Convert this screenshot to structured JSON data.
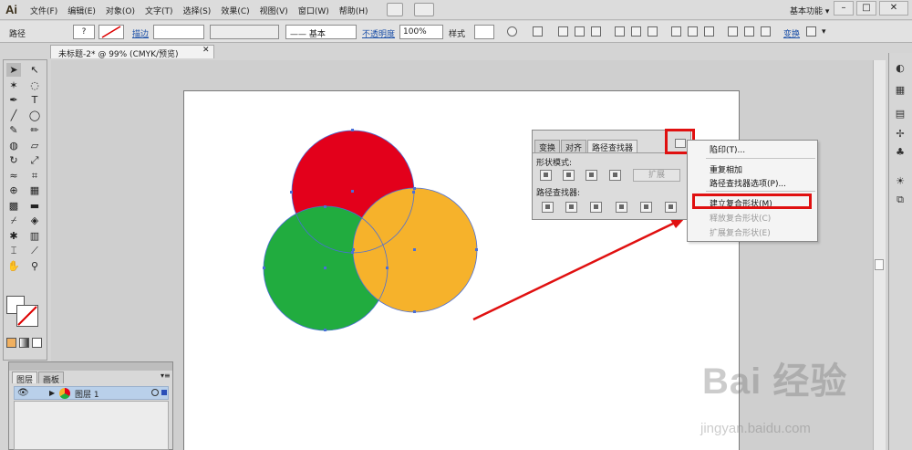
{
  "app": {
    "logo": "Ai"
  },
  "menu": [
    "文件(F)",
    "编辑(E)",
    "对象(O)",
    "文字(T)",
    "选择(S)",
    "效果(C)",
    "视图(V)",
    "窗口(W)",
    "帮助(H)"
  ],
  "workspace": {
    "label": "基本功能 ▾"
  },
  "window_controls": {
    "minimize": "–",
    "maximize": "□",
    "close": "✕"
  },
  "controlbar": {
    "selection_label": "路径",
    "fill_value": "?",
    "stroke_label": "描边",
    "brush_label": "—— 基本",
    "opacity_label": "不透明度",
    "opacity_value": "100%",
    "style_label": "样式",
    "transform_label": "变换"
  },
  "document": {
    "tab_title": "未标题-2* @ 99% (CMYK/预览)",
    "close": "✕"
  },
  "pathfinder": {
    "tabs": [
      "变换",
      "对齐",
      "路径查找器"
    ],
    "shape_modes_label": "形状模式:",
    "expand_label": "扩展",
    "pathfinders_label": "路径查找器:"
  },
  "flyout": {
    "items": [
      "陷印(T)...",
      "重复相加",
      "路径查找器选项(P)...",
      "建立复合形状(M)",
      "释放复合形状(C)",
      "扩展复合形状(E)"
    ],
    "highlighted": "建立复合形状(M)"
  },
  "layers": {
    "tabs": [
      "图层",
      "画板"
    ],
    "layer_name": "图层 1"
  },
  "artwork": {
    "circles": [
      {
        "name": "red-circle",
        "color": "#e3001b"
      },
      {
        "name": "green-circle",
        "color": "#21ac3f"
      },
      {
        "name": "orange-circle",
        "color": "#f6b22b"
      }
    ],
    "selection_color": "#4a6fd8",
    "arrow_color": "#e01010"
  },
  "watermark": {
    "logo": "Bai 经验",
    "url": "jingyan.baidu.com"
  }
}
